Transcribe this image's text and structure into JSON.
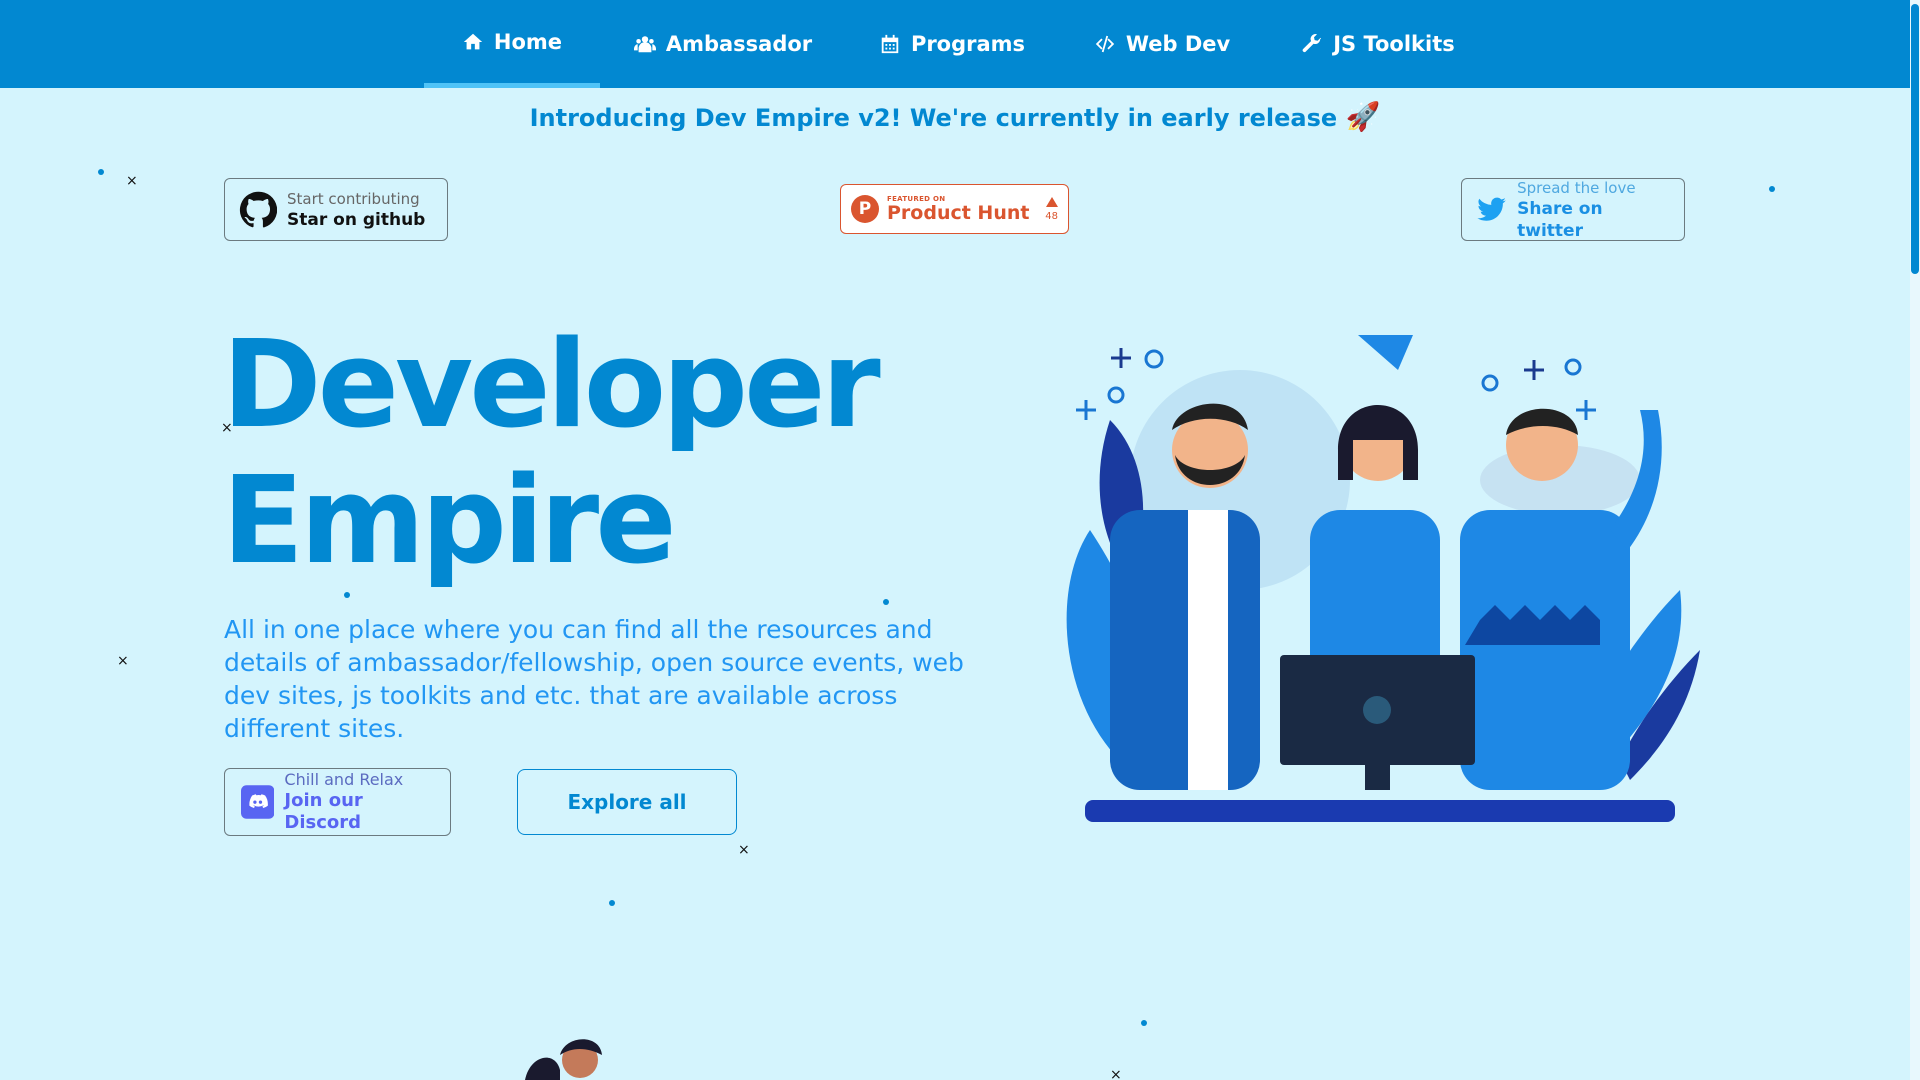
{
  "nav": {
    "items": [
      {
        "label": "Home",
        "icon": "home-icon",
        "active": true
      },
      {
        "label": "Ambassador",
        "icon": "users-icon",
        "active": false
      },
      {
        "label": "Programs",
        "icon": "calendar-icon",
        "active": false
      },
      {
        "label": "Web Dev",
        "icon": "code-icon",
        "active": false
      },
      {
        "label": "JS Toolkits",
        "icon": "wrench-icon",
        "active": false
      }
    ]
  },
  "announcement": {
    "text": "Introducing Dev Empire v2! We're currently in early release",
    "emoji": "🚀"
  },
  "github_badge": {
    "line1": "Start contributing",
    "line2": "Star on github",
    "icon": "github-icon"
  },
  "product_hunt": {
    "featured": "FEATURED ON",
    "name": "Product Hunt",
    "votes": "48",
    "logo_letter": "P"
  },
  "twitter_badge": {
    "line1": "Spread the love",
    "line2": "Share on twitter",
    "icon": "twitter-icon"
  },
  "hero": {
    "title_line1": "Developer",
    "title_line2": "Empire",
    "description": "All in one place where you can find all the resources and details of ambassador/fellowship, open source events, web dev sites, js toolkits and etc. that are available across different sites."
  },
  "discord_button": {
    "line1": "Chill and Relax",
    "line2": "Join our Discord",
    "icon": "discord-icon"
  },
  "explore_button": {
    "label": "Explore all"
  },
  "colors": {
    "nav_bg": "#0288d1",
    "page_bg": "#d4f4fd",
    "accent": "#0288d1",
    "product_hunt": "#da552f",
    "discord": "#5865f2",
    "twitter": "#1da1f2"
  }
}
